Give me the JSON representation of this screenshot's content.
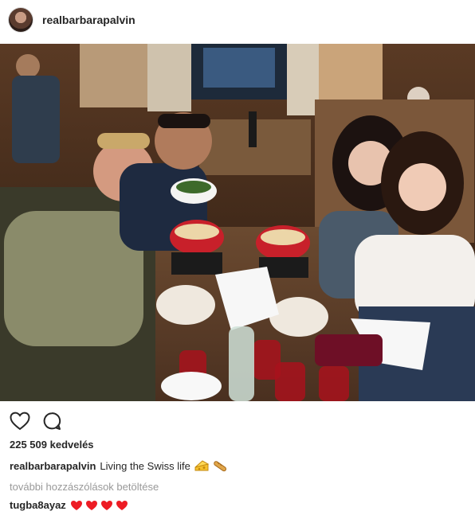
{
  "post": {
    "username": "realbarbarapalvin",
    "likes_text": "225 509 kedvelés",
    "caption": {
      "user": "realbarbarapalvin",
      "text": "Living the Swiss life",
      "emojis": [
        "cheese-icon",
        "bread-icon"
      ]
    },
    "load_more_label": "további hozzászólások betöltése",
    "comment": {
      "user": "tugba8ayaz",
      "hearts": 4
    }
  },
  "colors": {
    "text": "#262626",
    "muted": "#999999",
    "heart": "#ed1c24",
    "pot": "#c8202a"
  },
  "icons": {
    "like": "heart-outline-icon",
    "comment": "comment-bubble-icon"
  }
}
